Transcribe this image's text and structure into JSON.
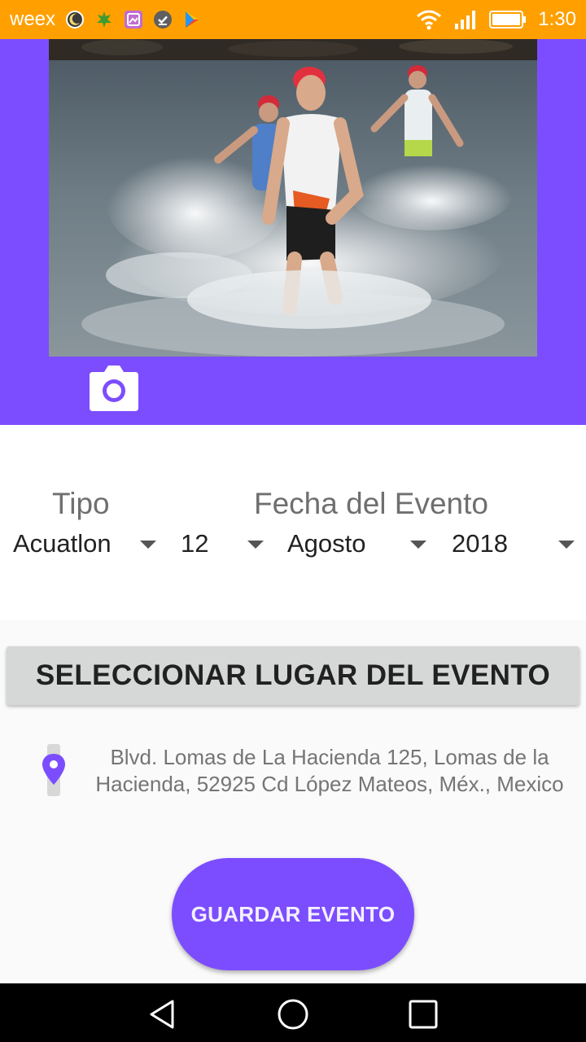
{
  "status_bar": {
    "carrier": "weex",
    "time": "1:30",
    "icons": [
      "moon-icon",
      "leaf-icon",
      "gallery-icon",
      "check-icon",
      "play-store-icon",
      "wifi-icon",
      "signal-icon",
      "battery-icon"
    ],
    "background": "#ffa000"
  },
  "hero": {
    "background": "#7c4dff",
    "photo_subject": "triathletes running out of the water",
    "camera_icon": "camera-icon"
  },
  "form": {
    "type_label": "Tipo",
    "date_label": "Fecha del Evento",
    "type_value": "Acuatlon",
    "day_value": "12",
    "month_value": "Agosto",
    "year_value": "2018"
  },
  "place": {
    "button_label": "SELECCIONAR LUGAR DEL EVENTO",
    "address": "Blvd. Lomas de La Hacienda 125, Lomas de la Hacienda, 52925 Cd López Mateos, Méx., Mexico",
    "pin_icon": "location-pin-icon"
  },
  "actions": {
    "save_label": "GUARDAR EVENTO"
  },
  "nav_bar": {
    "icons": [
      "back-icon",
      "home-icon",
      "recents-icon"
    ]
  },
  "colors": {
    "accent": "#7c4dff",
    "status": "#ffa000",
    "button_gray": "#d6d7d7"
  }
}
